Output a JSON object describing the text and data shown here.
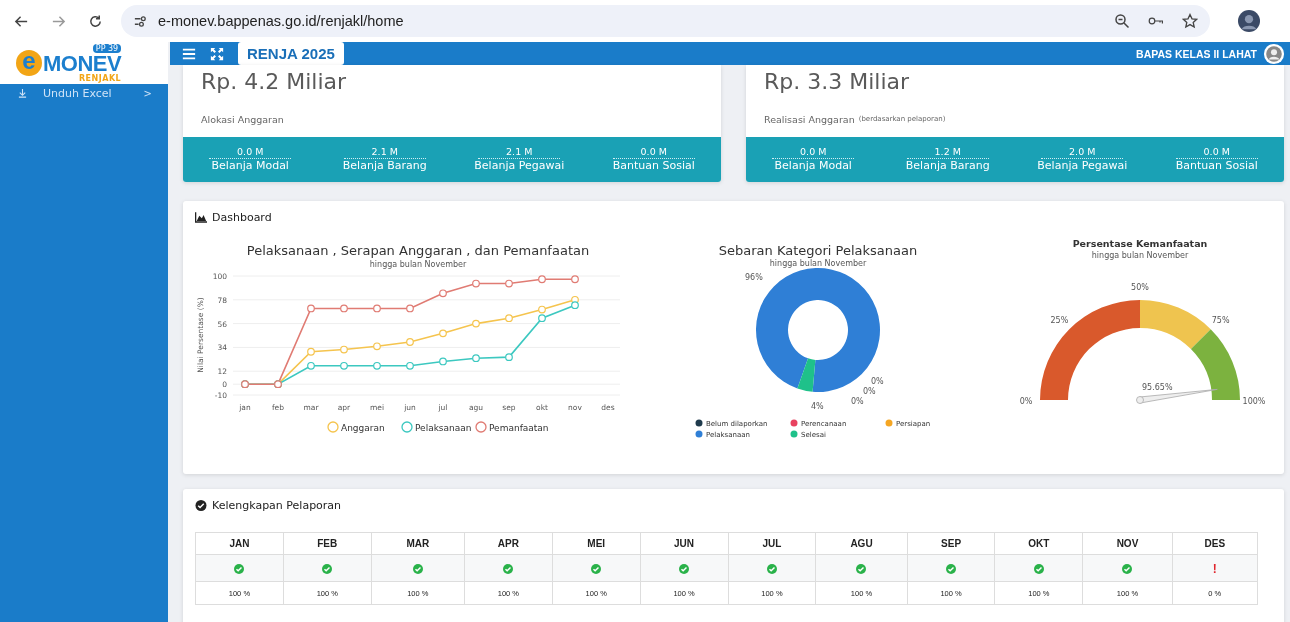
{
  "browser": {
    "url": "e-monev.bappenas.go.id/renjakl/home"
  },
  "logo": {
    "mark": "e",
    "name": "MONEV",
    "badge": "PP 39",
    "sub": "RENJAKL"
  },
  "sidebar": {
    "items": [
      {
        "label": "Unduh Excel",
        "chevron": ">"
      }
    ]
  },
  "header": {
    "badge": "RENJA 2025",
    "user": "BAPAS KELAS II LAHAT"
  },
  "summary_cards": [
    {
      "amount": "Rp. 4.2 Miliar",
      "label": "Alokasi Anggaran",
      "stats": [
        {
          "value": "0.0 M",
          "label": "Belanja Modal"
        },
        {
          "value": "2.1 M",
          "label": "Belanja Barang"
        },
        {
          "value": "2.1 M",
          "label": "Belanja Pegawai"
        },
        {
          "value": "0.0 M",
          "label": "Bantuan Sosial"
        }
      ]
    },
    {
      "amount": "Rp. 3.3 Miliar",
      "label": "Realisasi Anggaran",
      "note": "(berdasarkan pelaporan)",
      "stats": [
        {
          "value": "0.0 M",
          "label": "Belanja Modal"
        },
        {
          "value": "1.2 M",
          "label": "Belanja Barang"
        },
        {
          "value": "2.0 M",
          "label": "Belanja Pegawai"
        },
        {
          "value": "0.0 M",
          "label": "Bantuan Sosial"
        }
      ]
    }
  ],
  "dashboard": {
    "title": "Dashboard",
    "line_chart": {
      "subtitle": "hingga bulan November",
      "chart_data": {
        "type": "line",
        "grid": true,
        "legend": "bottom",
        "title": "Pelaksanaan , Serapan Anggaran , dan Pemanfaatan",
        "ylabel": "Nilai Persentase (%)",
        "categories": [
          "jan",
          "feb",
          "mar",
          "apr",
          "mei",
          "jun",
          "jul",
          "agu",
          "sep",
          "okt",
          "nov",
          "des"
        ],
        "ylim": [
          -10,
          100
        ],
        "yticks": [
          -10,
          0,
          12,
          34,
          56,
          78,
          100
        ],
        "series": [
          {
            "name": "Anggaran",
            "color": "#f5c44e",
            "marker": "circle",
            "values": [
              0,
              0,
              30,
              32,
              35,
              39,
              47,
              56,
              61,
              69,
              78,
              null
            ]
          },
          {
            "name": "Pelaksanaan",
            "color": "#3cc8c0",
            "marker": "circle",
            "values": [
              0,
              0,
              17,
              17,
              17,
              17,
              21,
              24,
              25,
              61,
              73,
              null
            ]
          },
          {
            "name": "Pemanfaatan",
            "color": "#e07b73",
            "marker": "circle",
            "values": [
              0,
              0,
              70,
              70,
              70,
              70,
              84,
              93,
              93,
              97,
              97,
              null
            ]
          }
        ]
      }
    },
    "donut_chart": {
      "subtitle": "hingga bulan November",
      "chart_data": {
        "type": "donut",
        "title": "Sebaran Kategori Pelaksanaan",
        "categories": [
          "Belum dilaporkan",
          "Perencanaan",
          "Persiapan",
          "Pelaksanaan",
          "Selesai"
        ],
        "values": [
          0,
          0,
          0,
          96,
          4
        ],
        "value_labels": [
          "0%",
          "0%",
          "0%",
          "96%",
          "4%"
        ],
        "legend": "bottom",
        "colors": [
          "#1f3b4d",
          "#e8425f",
          "#f5a623",
          "#2f7fd6",
          "#1fc18a"
        ]
      }
    },
    "gauge": {
      "title": "Persentase Kemanfaatan",
      "subtitle": "hingga bulan November",
      "reading": "95.65%",
      "ticks": [
        "0%",
        "25%",
        "50%",
        "75%",
        "100%"
      ]
    }
  },
  "reporting": {
    "title": "Kelengkapan Pelaporan",
    "months": [
      {
        "month": "JAN",
        "kind": "complete",
        "percent": "100 %"
      },
      {
        "month": "FEB",
        "kind": "complete",
        "percent": "100 %"
      },
      {
        "month": "MAR",
        "kind": "complete",
        "percent": "100 %"
      },
      {
        "month": "APR",
        "kind": "complete",
        "percent": "100 %"
      },
      {
        "month": "MEI",
        "kind": "complete",
        "percent": "100 %"
      },
      {
        "month": "JUN",
        "kind": "complete",
        "percent": "100 %"
      },
      {
        "month": "JUL",
        "kind": "complete",
        "percent": "100 %"
      },
      {
        "month": "AGU",
        "kind": "complete",
        "percent": "100 %"
      },
      {
        "month": "SEP",
        "kind": "complete",
        "percent": "100 %"
      },
      {
        "month": "OKT",
        "kind": "complete",
        "percent": "100 %"
      },
      {
        "month": "NOV",
        "kind": "complete",
        "percent": "100 %"
      },
      {
        "month": "DES",
        "kind": "missing",
        "mark": "!",
        "percent": "0 %"
      }
    ]
  }
}
